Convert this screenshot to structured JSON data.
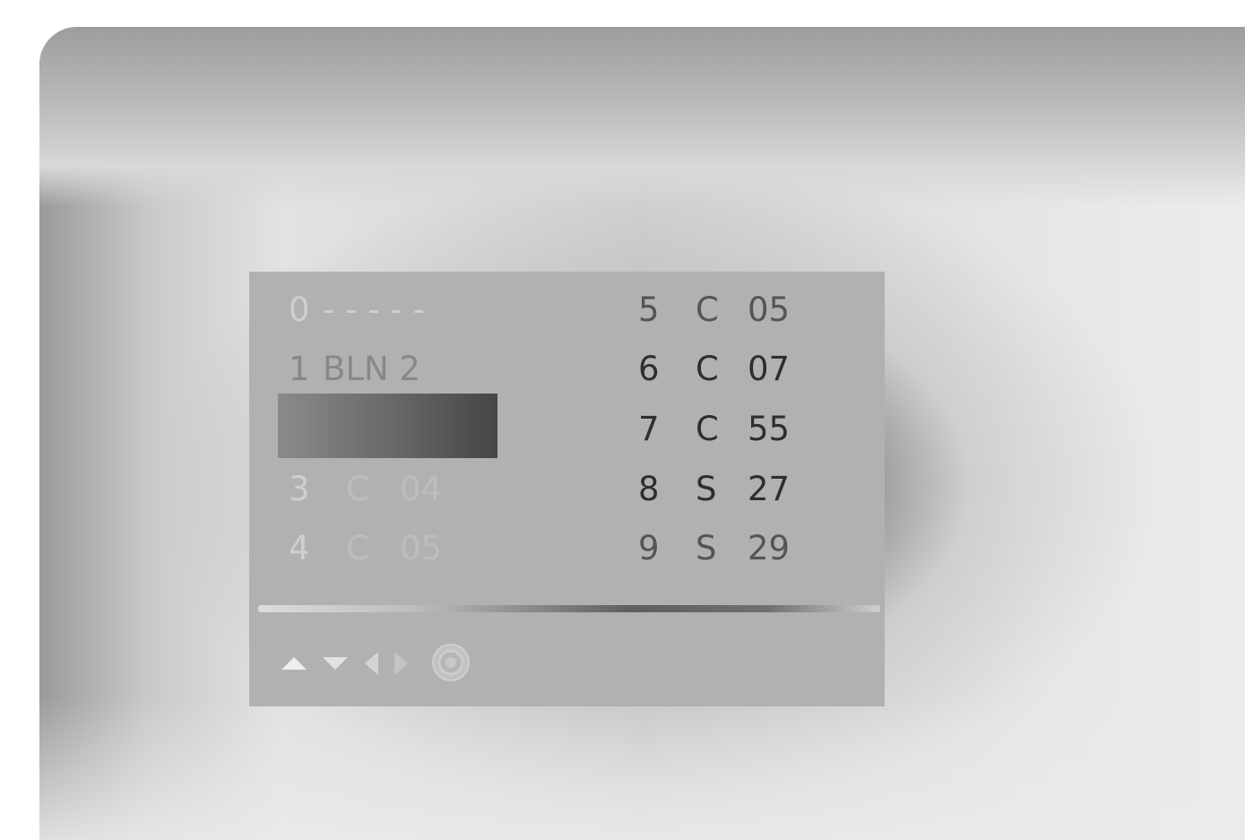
{
  "channel_list": {
    "left_rows": [
      {
        "num": "0",
        "type": "- - - - -",
        "value": ""
      },
      {
        "num": "1",
        "type": "BLN 2",
        "value": ""
      },
      {
        "num": "",
        "type": "",
        "value": ""
      },
      {
        "num": "3",
        "type": "C",
        "value": "04"
      },
      {
        "num": "4",
        "type": "C",
        "value": "05"
      }
    ],
    "right_rows": [
      {
        "num": "5",
        "type": "C",
        "value": "05"
      },
      {
        "num": "6",
        "type": "C",
        "value": "07"
      },
      {
        "num": "7",
        "type": "C",
        "value": "55"
      },
      {
        "num": "8",
        "type": "S",
        "value": "27"
      },
      {
        "num": "9",
        "type": "S",
        "value": "29"
      }
    ],
    "selected_index": 2
  },
  "nav_hint": {
    "icons": [
      "up-arrow-icon",
      "down-arrow-icon",
      "left-arrow-icon",
      "right-arrow-icon",
      "ok-button-icon"
    ]
  }
}
